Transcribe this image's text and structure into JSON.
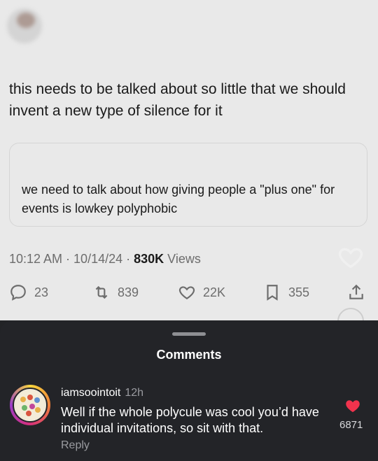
{
  "tweet": {
    "text": "this needs to be talked about so little that we should invent a new type of silence for it",
    "quote_text": "we need to talk about how giving people a \"plus one\" for events is lowkey polyphobic",
    "time": "10:12 AM · 10/14/24 · ",
    "views_count": "830K",
    "views_label": " Views",
    "replies": "23",
    "retweets": "839",
    "likes": "22K",
    "bookmarks": "355"
  },
  "comments_sheet": {
    "title": "Comments",
    "comment": {
      "username": "iamsoointoit",
      "time": "12h",
      "text": "Well if the whole polycule was cool you’d have individual invitations, so sit with that.",
      "reply_label": "Reply",
      "like_count": "6871"
    }
  },
  "colors": {
    "sheet_bg": "#232428",
    "tweet_bg": "#e9e9e9",
    "like_red": "#f0334d"
  },
  "icons": [
    "reply-icon",
    "retweet-icon",
    "heart-icon",
    "bookmark-icon",
    "share-icon",
    "liked-heart-icon"
  ]
}
